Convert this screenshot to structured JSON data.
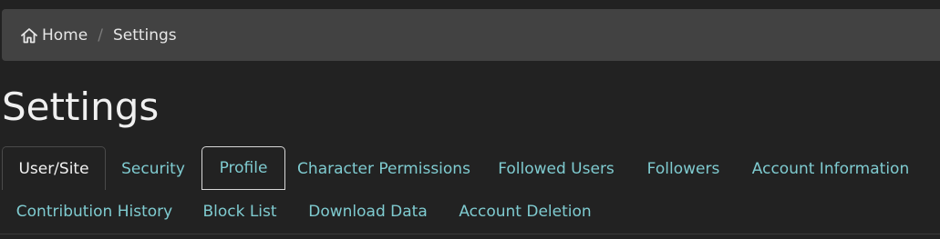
{
  "breadcrumb": {
    "home_label": "Home",
    "separator": "/",
    "current_label": "Settings"
  },
  "page": {
    "title": "Settings"
  },
  "tabs": [
    {
      "label": "User/Site",
      "state": "active"
    },
    {
      "label": "Security",
      "state": "normal"
    },
    {
      "label": "Profile",
      "state": "focused"
    },
    {
      "label": "Character Permissions",
      "state": "normal"
    },
    {
      "label": "Followed Users",
      "state": "normal"
    },
    {
      "label": "Followers",
      "state": "normal"
    },
    {
      "label": "Account Information",
      "state": "normal"
    },
    {
      "label": "Contribution History",
      "state": "normal"
    },
    {
      "label": "Block List",
      "state": "normal"
    },
    {
      "label": "Download Data",
      "state": "normal"
    },
    {
      "label": "Account Deletion",
      "state": "normal"
    }
  ],
  "colors": {
    "background": "#222222",
    "breadcrumb_bg": "#424242",
    "link": "#7fcbd0",
    "text": "#f0f0f0"
  },
  "icons": {
    "home": "home-icon"
  }
}
